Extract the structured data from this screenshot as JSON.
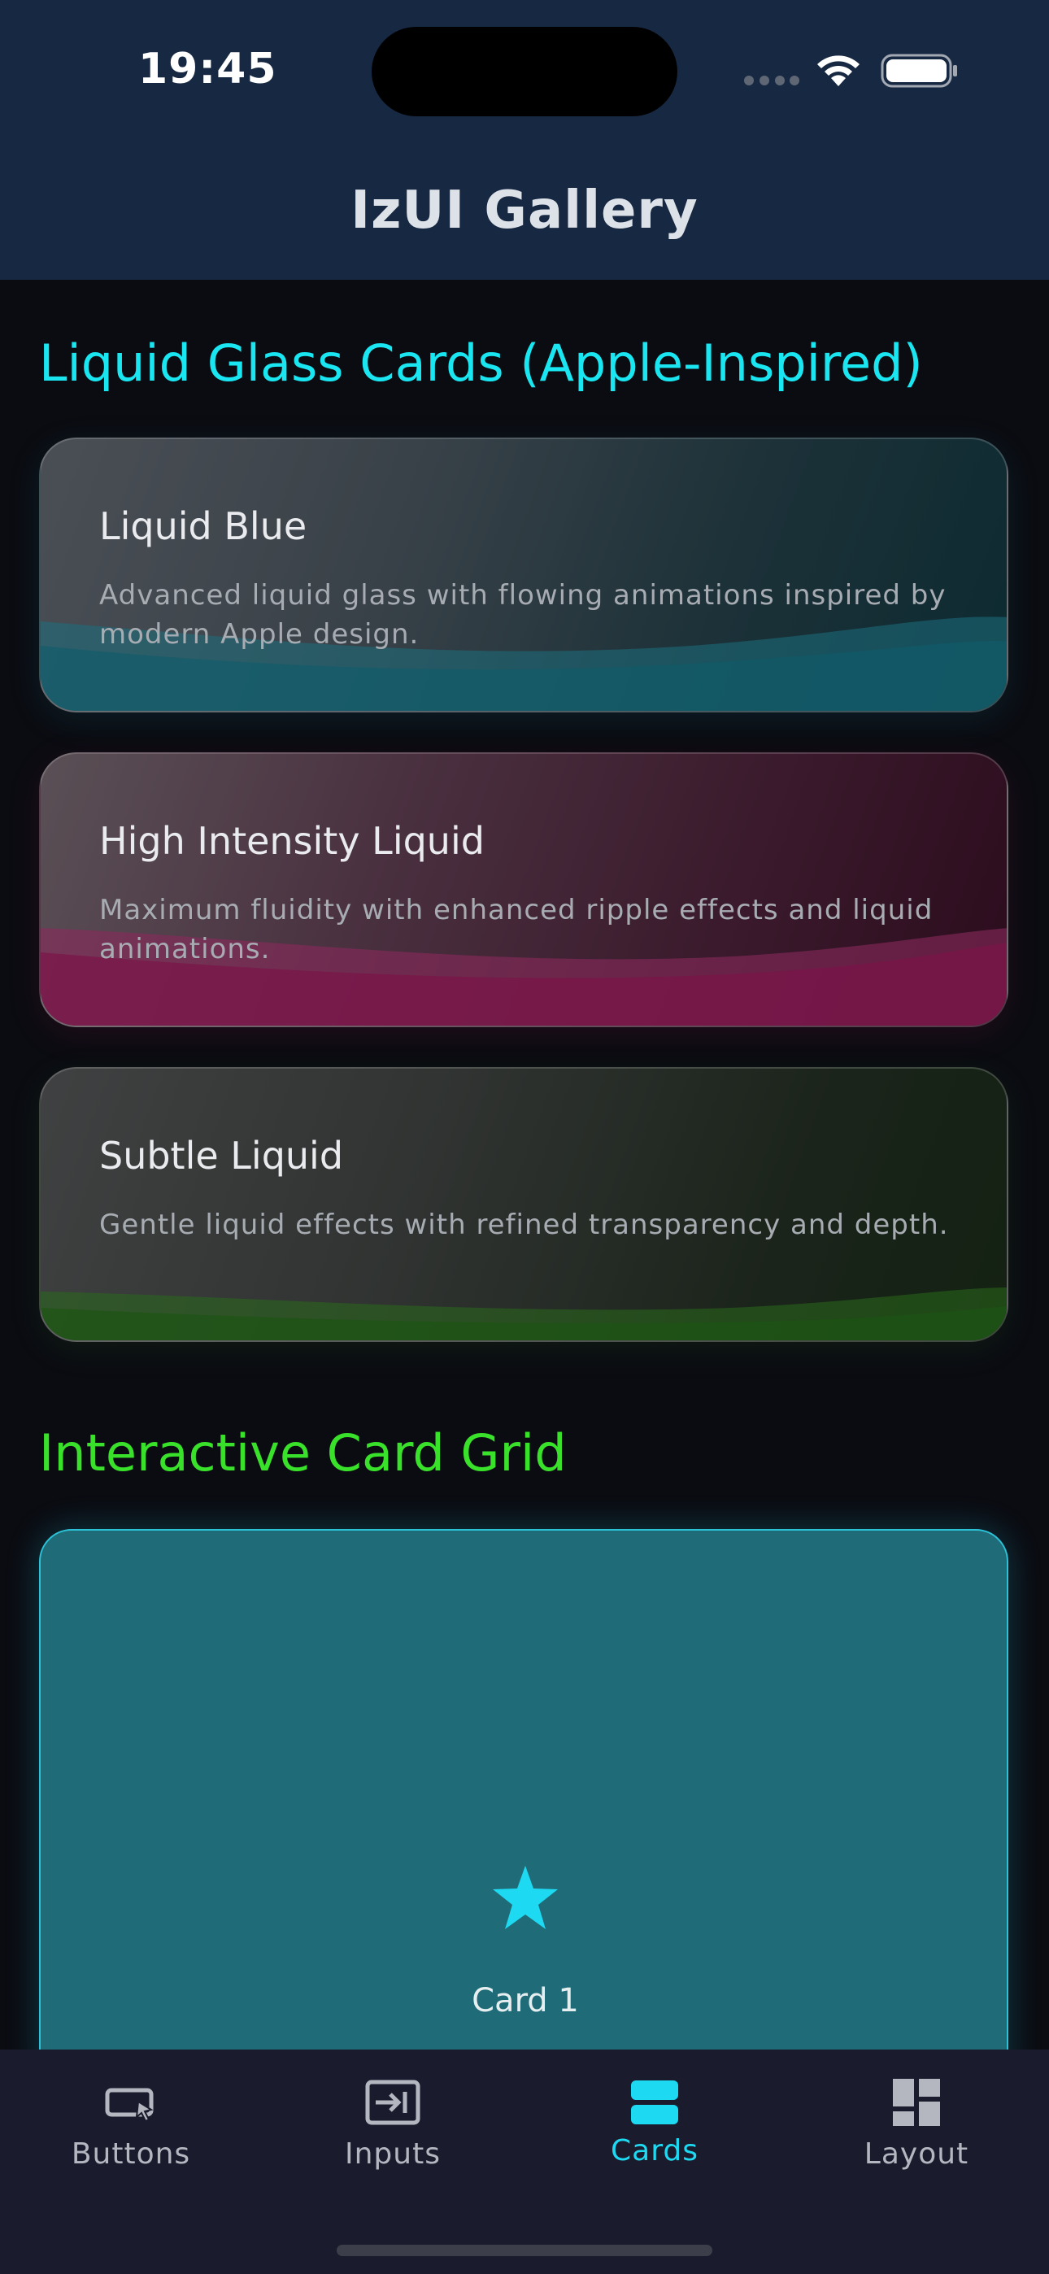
{
  "status_bar": {
    "time": "19:45"
  },
  "header": {
    "title": "IzUI Gallery"
  },
  "sections": {
    "glass_title": "Liquid Glass Cards (Apple-Inspired)",
    "grid_title": "Interactive Card Grid"
  },
  "glass_cards": [
    {
      "title": "Liquid Blue",
      "description": "Advanced liquid glass with flowing animations inspired by modern Apple design.",
      "accent": "#1c6f7e"
    },
    {
      "title": "High Intensity Liquid",
      "description": "Maximum fluidity with enhanced ripple effects and liquid animations.",
      "accent": "#8a1c52"
    },
    {
      "title": "Subtle Liquid",
      "description": "Gentle liquid effects with refined transparency and depth.",
      "accent": "#2a6a1c"
    }
  ],
  "grid_cards": [
    {
      "label": "Card 1",
      "icon": "star-icon"
    }
  ],
  "tabs": [
    {
      "label": "Buttons",
      "icon": "buttons-icon"
    },
    {
      "label": "Inputs",
      "icon": "inputs-icon"
    },
    {
      "label": "Cards",
      "icon": "cards-icon",
      "active": true
    },
    {
      "label": "Layout",
      "icon": "layout-icon"
    }
  ],
  "colors": {
    "accent": "#1ed9f2",
    "grid_heading": "#39e12a",
    "header_bg": "#172842"
  }
}
